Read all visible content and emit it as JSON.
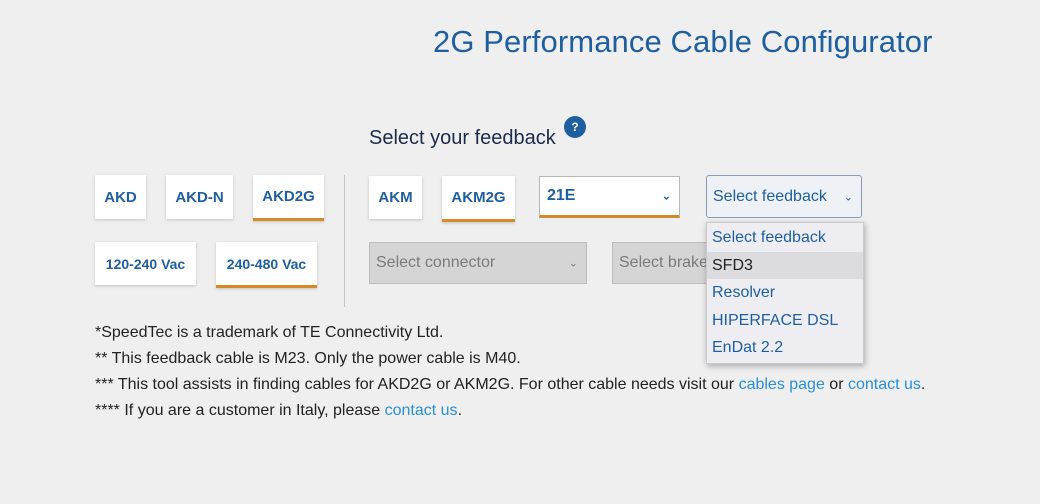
{
  "title": "2G Performance Cable Configurator",
  "subtitle": "Select your feedback",
  "help_glyph": "?",
  "drive_buttons": {
    "akd": "AKD",
    "akd_n": "AKD-N",
    "akd2g": "AKD2G"
  },
  "voltage_buttons": {
    "v120_240": "120-240 Vac",
    "v240_480": "240-480 Vac"
  },
  "motor_buttons": {
    "akm": "AKM",
    "akm2g": "AKM2G"
  },
  "selects": {
    "motor_model": "21E",
    "feedback": "Select feedback",
    "connector": "Select connector",
    "brake": "Select brake"
  },
  "feedback_options": [
    "Select feedback",
    "SFD3",
    "Resolver",
    "HIPERFACE DSL",
    "EnDat 2.2"
  ],
  "notes": {
    "line1": "*SpeedTec is a trademark of TE Connectivity Ltd.",
    "line2": "** This feedback cable is M23. Only the power cable is M40.",
    "line3_prefix": "*** This tool assists in finding cables for AKD2G or AKM2G. For other cable needs visit our ",
    "line3_link1": "cables page",
    "line3_mid": " or ",
    "line3_link2": "contact us",
    "line3_suffix": ".",
    "line4_prefix": "**** If you are a customer in Italy, please ",
    "line4_link": "contact us",
    "line4_suffix": "."
  },
  "colors": {
    "accent_blue": "#1f5fa0",
    "selected_underline": "#d4892a",
    "link": "#2a8fd9",
    "background": "#efefef"
  }
}
